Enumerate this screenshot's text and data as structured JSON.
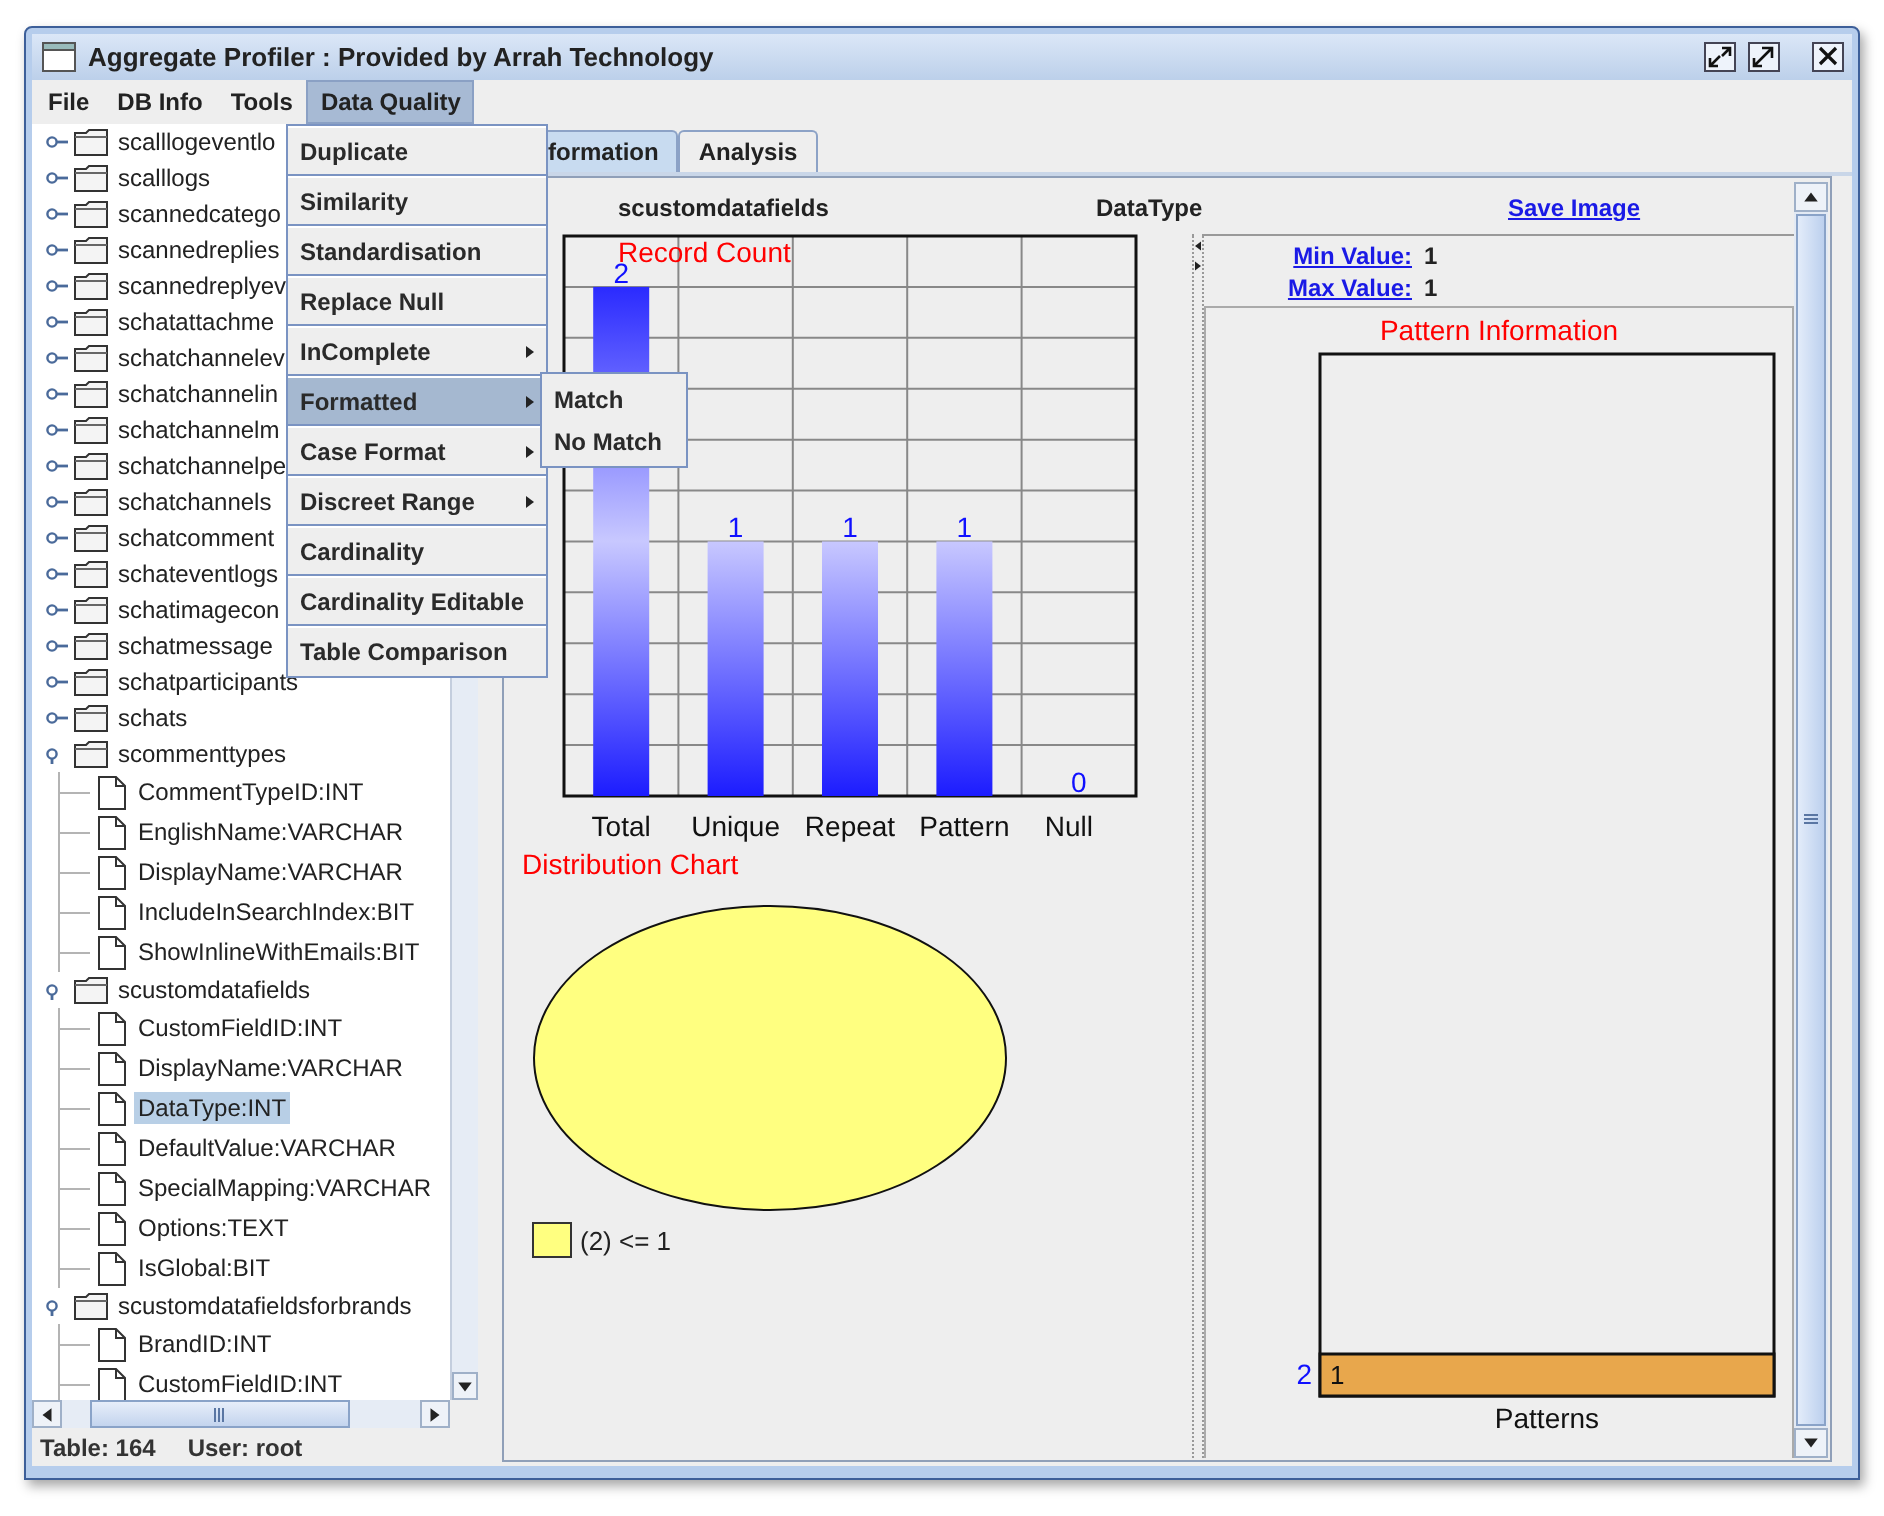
{
  "window": {
    "title": "Aggregate Profiler : Provided by Arrah Technology"
  },
  "menu_bar": [
    {
      "label": "File",
      "selected": false
    },
    {
      "label": "DB Info",
      "selected": false
    },
    {
      "label": "Tools",
      "selected": false
    },
    {
      "label": "Data Quality",
      "selected": true
    }
  ],
  "data_quality_menu": {
    "items": [
      {
        "label": "Duplicate",
        "has_submenu": false,
        "selected": false
      },
      {
        "label": "Similarity",
        "has_submenu": false,
        "selected": false
      },
      {
        "label": "Standardisation",
        "has_submenu": false,
        "selected": false
      },
      {
        "label": "Replace Null",
        "has_submenu": false,
        "selected": false
      },
      {
        "label": "InComplete",
        "has_submenu": true,
        "selected": false
      },
      {
        "label": "Formatted",
        "has_submenu": true,
        "selected": true
      },
      {
        "label": "Case Format",
        "has_submenu": true,
        "selected": false
      },
      {
        "label": "Discreet Range",
        "has_submenu": true,
        "selected": false
      },
      {
        "label": "Cardinality",
        "has_submenu": false,
        "selected": false
      },
      {
        "label": "Cardinality Editable",
        "has_submenu": false,
        "selected": false
      },
      {
        "label": "Table Comparison",
        "has_submenu": false,
        "selected": false
      }
    ]
  },
  "formatted_submenu": {
    "items": [
      {
        "label": "Match",
        "selected": false
      },
      {
        "label": "No Match",
        "selected": false
      }
    ]
  },
  "tree": {
    "items": [
      {
        "label": "scalllogeventlo",
        "kind": "table",
        "expanded": false,
        "selected": false
      },
      {
        "label": "scalllogs",
        "kind": "table",
        "expanded": false,
        "selected": false
      },
      {
        "label": "scannedcatego",
        "kind": "table",
        "expanded": false,
        "selected": false
      },
      {
        "label": "scannedreplies",
        "kind": "table",
        "expanded": false,
        "selected": false
      },
      {
        "label": "scannedreplyev",
        "kind": "table",
        "expanded": false,
        "selected": false
      },
      {
        "label": "schatattachme",
        "kind": "table",
        "expanded": false,
        "selected": false
      },
      {
        "label": "schatchannelev",
        "kind": "table",
        "expanded": false,
        "selected": false
      },
      {
        "label": "schatchannelin",
        "kind": "table",
        "expanded": false,
        "selected": false
      },
      {
        "label": "schatchannelm",
        "kind": "table",
        "expanded": false,
        "selected": false
      },
      {
        "label": "schatchannelpe",
        "kind": "table",
        "expanded": false,
        "selected": false
      },
      {
        "label": "schatchannels",
        "kind": "table",
        "expanded": false,
        "selected": false
      },
      {
        "label": "schatcomment",
        "kind": "table",
        "expanded": false,
        "selected": false
      },
      {
        "label": "schateventlogs",
        "kind": "table",
        "expanded": false,
        "selected": false
      },
      {
        "label": "schatimagecon",
        "kind": "table",
        "expanded": false,
        "selected": false
      },
      {
        "label": "schatmessage",
        "kind": "table",
        "expanded": false,
        "selected": false
      },
      {
        "label": "schatparticipants",
        "kind": "table",
        "expanded": false,
        "selected": false
      },
      {
        "label": "schats",
        "kind": "table",
        "expanded": false,
        "selected": false
      },
      {
        "label": "scommenttypes",
        "kind": "table",
        "expanded": true,
        "selected": false,
        "children": [
          {
            "label": "CommentTypeID:INT",
            "kind": "column",
            "selected": false
          },
          {
            "label": "EnglishName:VARCHAR",
            "kind": "column",
            "selected": false
          },
          {
            "label": "DisplayName:VARCHAR",
            "kind": "column",
            "selected": false
          },
          {
            "label": "IncludeInSearchIndex:BIT",
            "kind": "column",
            "selected": false
          },
          {
            "label": "ShowInlineWithEmails:BIT",
            "kind": "column",
            "selected": false
          }
        ]
      },
      {
        "label": "scustomdatafields",
        "kind": "table",
        "expanded": true,
        "selected": false,
        "children": [
          {
            "label": "CustomFieldID:INT",
            "kind": "column",
            "selected": false
          },
          {
            "label": "DisplayName:VARCHAR",
            "kind": "column",
            "selected": false
          },
          {
            "label": "DataType:INT",
            "kind": "column",
            "selected": true
          },
          {
            "label": "DefaultValue:VARCHAR",
            "kind": "column",
            "selected": false
          },
          {
            "label": "SpecialMapping:VARCHAR",
            "kind": "column",
            "selected": false
          },
          {
            "label": "Options:TEXT",
            "kind": "column",
            "selected": false
          },
          {
            "label": "IsGlobal:BIT",
            "kind": "column",
            "selected": false
          }
        ]
      },
      {
        "label": "scustomdatafieldsforbrands",
        "kind": "table",
        "expanded": true,
        "selected": false,
        "children": [
          {
            "label": "BrandID:INT",
            "kind": "column",
            "selected": false
          },
          {
            "label": "CustomFieldID:INT",
            "kind": "column",
            "selected": false
          }
        ]
      }
    ]
  },
  "status_bar": {
    "table": "Table: 164",
    "user": "User: root"
  },
  "tabs": [
    {
      "label": "formation",
      "selected": true
    },
    {
      "label": "Analysis",
      "selected": false
    }
  ],
  "profile": {
    "table_name": "scustomdatafields",
    "column_name": "DataType",
    "save_image": "Save Image",
    "record_count": {
      "chart_data": {
        "type": "bar",
        "title": "Record Count",
        "categories": [
          "Total",
          "Unique",
          "Repeat",
          "Pattern",
          "Null"
        ],
        "values": [
          2,
          1,
          1,
          1,
          0
        ],
        "data_labels": true
      }
    },
    "distribution": {
      "chart_data": {
        "type": "pie",
        "title": "Distribution Chart",
        "categories": [
          "(2) <= 1"
        ]
      }
    },
    "min_value": {
      "label": "Min Value:",
      "value": "1"
    },
    "max_value": {
      "label": "Max Value:",
      "value": "1"
    },
    "pattern_information": {
      "chart_data": {
        "type": "bar",
        "orientation": "horizontal",
        "title": "Pattern Information",
        "xlabel": "Patterns",
        "categories": [
          "1"
        ],
        "values": [
          2
        ],
        "data_labels": true
      }
    }
  }
}
